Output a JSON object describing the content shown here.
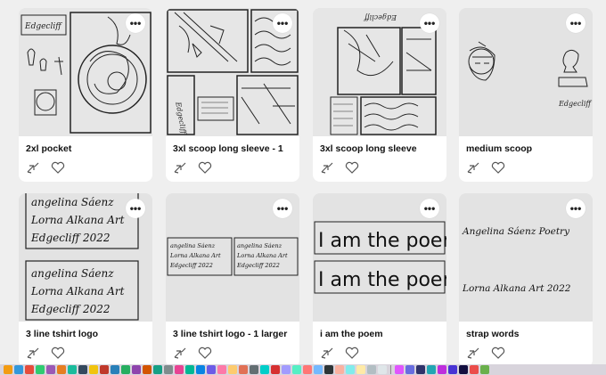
{
  "cards": [
    {
      "title": "2xl pocket"
    },
    {
      "title": "3xl scoop long sleeve - 1"
    },
    {
      "title": "3xl scoop long sleeve"
    },
    {
      "title": "medium scoop"
    },
    {
      "title": "3 line tshirt logo"
    },
    {
      "title": "3 line tshirt logo - 1 larger"
    },
    {
      "title": "i am the poem"
    },
    {
      "title": "strap words"
    }
  ],
  "more_glyph": "•••",
  "art_text": {
    "edgecliff": "Edgecliff",
    "logo_line1": "angelina Sáenz",
    "logo_line2": "Lorna Alkana Art",
    "logo_line3": "Edgecliff 2022",
    "poem": "I am the poem",
    "strap1": "Angelina Sáenz Poetry",
    "strap2": "Lorna Alkana Art 2022"
  },
  "icons": {
    "more": "more-options-icon",
    "share": "share-arrow-icon",
    "like": "heart-icon"
  },
  "dock": {
    "app_colors": [
      "#f39c12",
      "#3498db",
      "#e74c3c",
      "#2ecc71",
      "#9b59b6",
      "#e67e22",
      "#1abc9c",
      "#34495e",
      "#f1c40f",
      "#c0392b",
      "#2980b9",
      "#27ae60",
      "#8e44ad",
      "#d35400",
      "#16a085",
      "#7f8c8d",
      "#e84393",
      "#00b894",
      "#0984e3",
      "#6c5ce7",
      "#fd79a8",
      "#fdcb6e",
      "#e17055",
      "#636e72",
      "#00cec9",
      "#d63031",
      "#a29bfe",
      "#55efc4",
      "#ff7675",
      "#74b9ff",
      "#2d3436",
      "#fab1a0",
      "#81ecec",
      "#ffeaa7",
      "#b2bec3",
      "#dfe6e9",
      "#e056fd",
      "#686de0",
      "#30336b",
      "#22a6b3",
      "#be2edd",
      "#4834d4",
      "#130f40",
      "#eb4d4b",
      "#6ab04c"
    ]
  }
}
